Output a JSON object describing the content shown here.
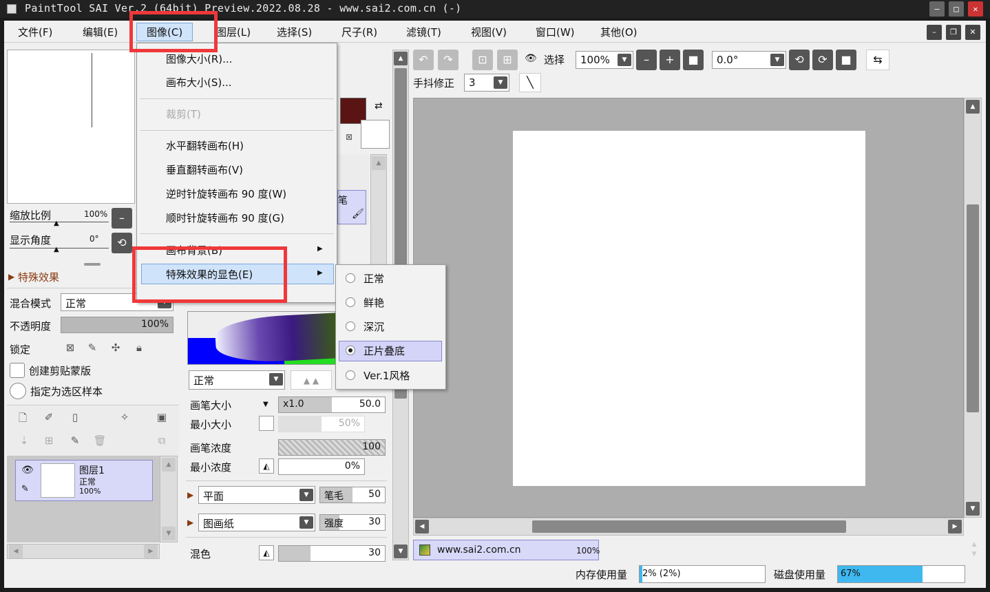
{
  "window": {
    "title": "PaintTool SAI Ver.2 (64bit) Preview.2022.08.28 - www.sai2.com.cn (-)",
    "controls": [
      "–",
      "□",
      "✕"
    ]
  },
  "menubar": {
    "items": [
      "文件(F)",
      "编辑(E)",
      "图像(C)",
      "图层(L)",
      "选择(S)",
      "尺子(R)",
      "滤镜(T)",
      "视图(V)",
      "窗口(W)",
      "其他(O)"
    ],
    "active": "图像(C)"
  },
  "image_menu": {
    "items": [
      {
        "label": "图像大小(R)...",
        "enabled": true
      },
      {
        "label": "画布大小(S)...",
        "enabled": true
      },
      {
        "label": "裁剪(T)",
        "enabled": false
      },
      {
        "label": "水平翻转画布(H)",
        "enabled": true
      },
      {
        "label": "垂直翻转画布(V)",
        "enabled": true
      },
      {
        "label": "逆时针旋转画布 90 度(W)",
        "enabled": true
      },
      {
        "label": "顺时针旋转画布 90 度(G)",
        "enabled": true
      },
      {
        "label": "画布背景(B)",
        "enabled": true,
        "submenu": true
      },
      {
        "label": "特殊效果的显色(E)",
        "enabled": true,
        "submenu": true,
        "highlighted": true
      }
    ]
  },
  "effect_submenu": {
    "items": [
      "正常",
      "鲜艳",
      "深沉",
      "正片叠底",
      "Ver.1风格"
    ],
    "selected": "正片叠底"
  },
  "navigator": {
    "zoom_label": "缩放比例",
    "zoom_value": "100%",
    "angle_label": "显示角度",
    "angle_value": "0°"
  },
  "layer_panel": {
    "effects_header": "特殊效果",
    "blend_label": "混合模式",
    "blend_value": "正常",
    "opacity_label": "不透明度",
    "opacity_value": "100%",
    "opacity_percent": 100,
    "lock_label": "锁定",
    "clip_label": "创建剪贴蒙版",
    "sample_label": "指定为选区样本",
    "layer": {
      "name": "图层1",
      "mode": "正常",
      "opacity": "100%"
    }
  },
  "tool_panel": {
    "mode_value": "正常",
    "brush_size_label": "画笔大小",
    "brush_size_mult": "x1.0",
    "brush_size_value": "50.0",
    "min_size_label": "最小大小",
    "min_size_value": "50%",
    "density_label": "画笔浓度",
    "density_value": "100",
    "min_density_label": "最小浓度",
    "min_density_value": "0%",
    "shape_value": "平面",
    "bristle_label": "笔毛",
    "bristle_value": "50",
    "texture_value": "图画纸",
    "strength_label": "强度",
    "strength_value": "30",
    "blend_label": "混色",
    "blend_value": "30",
    "tool_name_fragment": "笔"
  },
  "canvas_toolbar": {
    "select_label": "选择",
    "zoom_value": "100%",
    "angle_value": "0.0°",
    "stabilizer_label": "手抖修正",
    "stabilizer_value": "3"
  },
  "document_tab": {
    "name": "www.sai2.com.cn",
    "zoom": "100%"
  },
  "statusbar": {
    "memory_label": "内存使用量",
    "memory_value": "2% (2%)",
    "memory_percent": 2,
    "disk_label": "磁盘使用量",
    "disk_value": "67%",
    "disk_percent": 67
  },
  "colors": {
    "primary": "#5a1414",
    "secondary": "#ffffff",
    "accent_highlight": "#cfe3fa",
    "annotation_red": "#f0383a",
    "disk_bar": "#3fb8f0"
  }
}
